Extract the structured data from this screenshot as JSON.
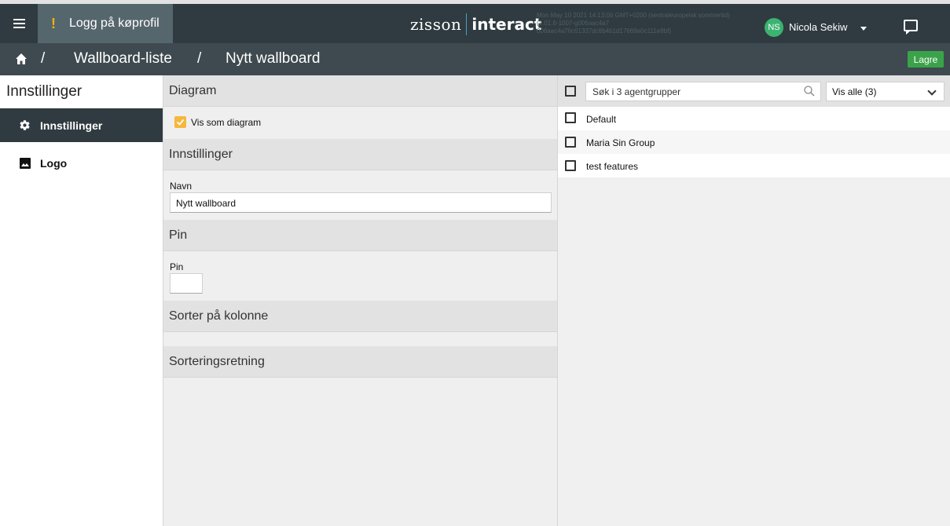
{
  "topbar": {
    "login_label": "Logg på køprofil",
    "login_alert": "!",
    "brand_left": "zisson",
    "brand_right": "interact",
    "build_line1": "Mon May 10 2021 14:13:06 GMT+0200 (sentraleuropeisk sommertid)",
    "build_line2": "(1.01.6-1007-g006aac4a7",
    "build_line3": "006aac4a76c61337dc8b4b1d17669a0c111e8bf)",
    "avatar_initials": "NS",
    "user_name": "Nicola Sekiw",
    "avatar_color": "#3cb371"
  },
  "breadcrumb": {
    "sep1": "/",
    "item1": "Wallboard-liste",
    "sep2": "/",
    "item2": "Nytt wallboard",
    "save_label": "Lagre",
    "save_color": "#3aa34a"
  },
  "sidebar": {
    "title": "Innstillinger",
    "items": [
      {
        "label": "Innstillinger",
        "icon": "gear-icon",
        "active": true
      },
      {
        "label": "Logo",
        "icon": "image-icon",
        "active": false
      }
    ]
  },
  "settings": {
    "diagram_header": "Diagram",
    "diagram_checkbox_label": "Vis som diagram",
    "diagram_checked": true,
    "settings_header": "Innstillinger",
    "name_label": "Navn",
    "name_value": "Nytt wallboard",
    "pin_header": "Pin",
    "pin_label": "Pin",
    "pin_value": "",
    "sort_column_header": "Sorter på kolonne",
    "sort_direction_header": "Sorteringsretning",
    "accent_color": "#f6b73c"
  },
  "groups": {
    "search_placeholder": "Søk i 3 agentgrupper",
    "filter_value": "Vis alle (3)",
    "items": [
      {
        "label": "Default",
        "checked": false
      },
      {
        "label": "Maria Sin Group",
        "checked": false
      },
      {
        "label": "test features",
        "checked": false
      }
    ]
  }
}
